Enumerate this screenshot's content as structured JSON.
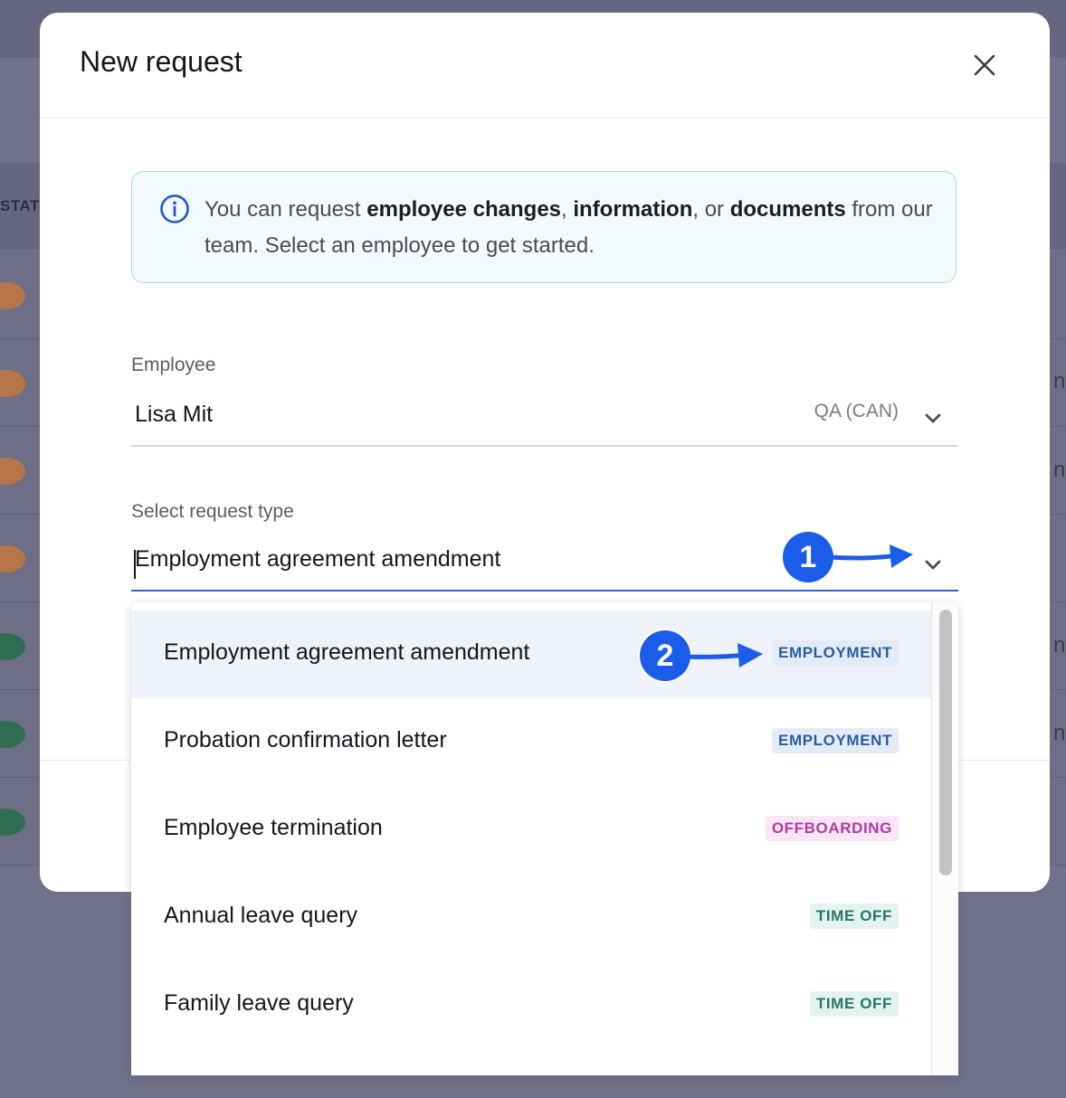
{
  "background": {
    "status_column_header": "STATU",
    "row_fragments": [
      "n",
      "n",
      "n",
      "n"
    ],
    "avatar_colors": [
      "#b7764a",
      "#b7764a",
      "#b7764a",
      "#b7764a",
      "#2f6d52",
      "#2f6d52",
      "#2f6d52"
    ]
  },
  "modal": {
    "title": "New request",
    "close_icon": "close-icon"
  },
  "info": {
    "icon": "info-circle-icon",
    "text_1": "You can request ",
    "bold_1": "employee changes",
    "text_2": ", ",
    "bold_2": "information",
    "text_3": ", or ",
    "bold_3": "documents",
    "text_4": " from our team. Select an employee to get started."
  },
  "employee_field": {
    "label": "Employee",
    "value": "Lisa Mit",
    "secondary": "QA (CAN)",
    "icon": "chevron-down-icon"
  },
  "request_type_field": {
    "label": "Select request type",
    "value": "Employment agreement amendment",
    "icon": "chevron-down-icon"
  },
  "dropdown": {
    "options": [
      {
        "label": "Employment agreement amendment",
        "tag": "EMPLOYMENT",
        "selected": true
      },
      {
        "label": "Probation confirmation letter",
        "tag": "EMPLOYMENT",
        "selected": false
      },
      {
        "label": "Employee termination",
        "tag": "OFFBOARDING",
        "selected": false
      },
      {
        "label": "Annual leave query",
        "tag": "TIME OFF",
        "selected": false
      },
      {
        "label": "Family leave query",
        "tag": "TIME OFF",
        "selected": false
      }
    ]
  },
  "tag_colors": {
    "EMPLOYMENT": {
      "bg": "#e3ecf6",
      "fg": "#2a5d9f"
    },
    "OFFBOARDING": {
      "bg": "#fbe6f5",
      "fg": "#b13aa3"
    },
    "TIME OFF": {
      "bg": "#e3f3f1",
      "fg": "#2b7569"
    }
  },
  "annotations": {
    "marker_1": "1",
    "marker_2": "2",
    "accent": "#1b5de8"
  }
}
